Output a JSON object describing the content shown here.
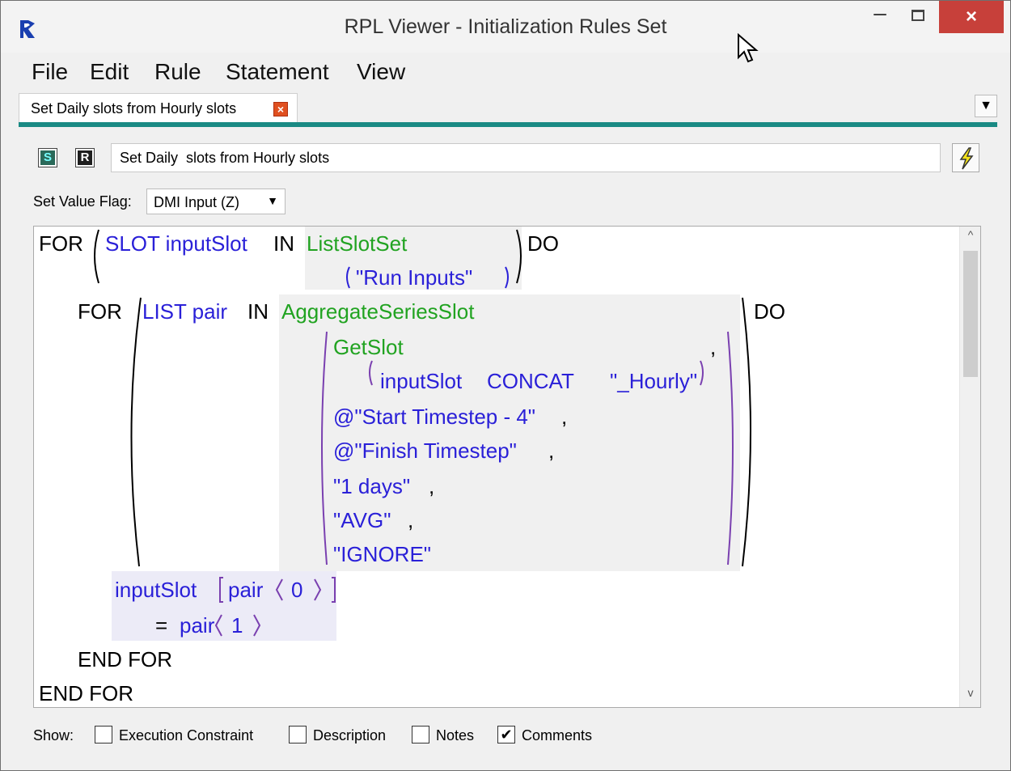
{
  "window": {
    "title": "RPL Viewer - Initialization Rules Set",
    "minimize_glyph": "–",
    "close_glyph": "×"
  },
  "menu": [
    "File",
    "Edit",
    "Rule",
    "Statement",
    "View"
  ],
  "tab": {
    "label": "Set Daily  slots from Hourly slots",
    "close_glyph": "×",
    "menu_glyph": "▼"
  },
  "toolbar": {
    "s_button": "S",
    "r_button": "R",
    "rule_name": "Set Daily  slots from Hourly slots",
    "bolt_icon": "lightning-icon"
  },
  "flag": {
    "label": "Set Value Flag:",
    "selected": "DMI Input (Z)",
    "arrow": "▼"
  },
  "code": {
    "for1": "FOR",
    "slot_decl": "SLOT inputSlot",
    "in1": "IN",
    "list_slot_set": "ListSlotSet",
    "run_inputs": "\"Run Inputs\"",
    "do1": "DO",
    "for2": "FOR",
    "list_decl": "LIST pair",
    "in2": "IN",
    "aggregate": "AggregateSeriesSlot",
    "getslot": "GetSlot",
    "comma0": ",",
    "input_slot_arg": "inputSlot",
    "concat": "CONCAT",
    "hourly": "\"_Hourly\"",
    "start_ts": "@\"Start Timestep - 4\"",
    "comma1": ",",
    "finish_ts": "@\"Finish Timestep\"",
    "comma2": ",",
    "days": "\"1 days\"",
    "comma3": ",",
    "avg": "\"AVG\"",
    "comma4": ",",
    "ignore": "\"IGNORE\"",
    "do2": "DO",
    "assign_target": "inputSlot",
    "pair0": "pair",
    "idx0": "0",
    "equals": "=",
    "pair1": "pair",
    "idx1": "1",
    "end_for_inner": "END FOR",
    "end_for_outer": "END FOR"
  },
  "show": {
    "label": "Show:",
    "options": [
      {
        "label": "Execution Constraint",
        "checked": false
      },
      {
        "label": "Description",
        "checked": false
      },
      {
        "label": "Notes",
        "checked": false
      },
      {
        "label": "Comments",
        "checked": true
      }
    ],
    "check_glyph": "✔"
  },
  "colors": {
    "keyword": "#000000",
    "variable": "#2a20d8",
    "function": "#21a321",
    "accent_rule": "#1a8a84",
    "close_button": "#c7403a"
  }
}
